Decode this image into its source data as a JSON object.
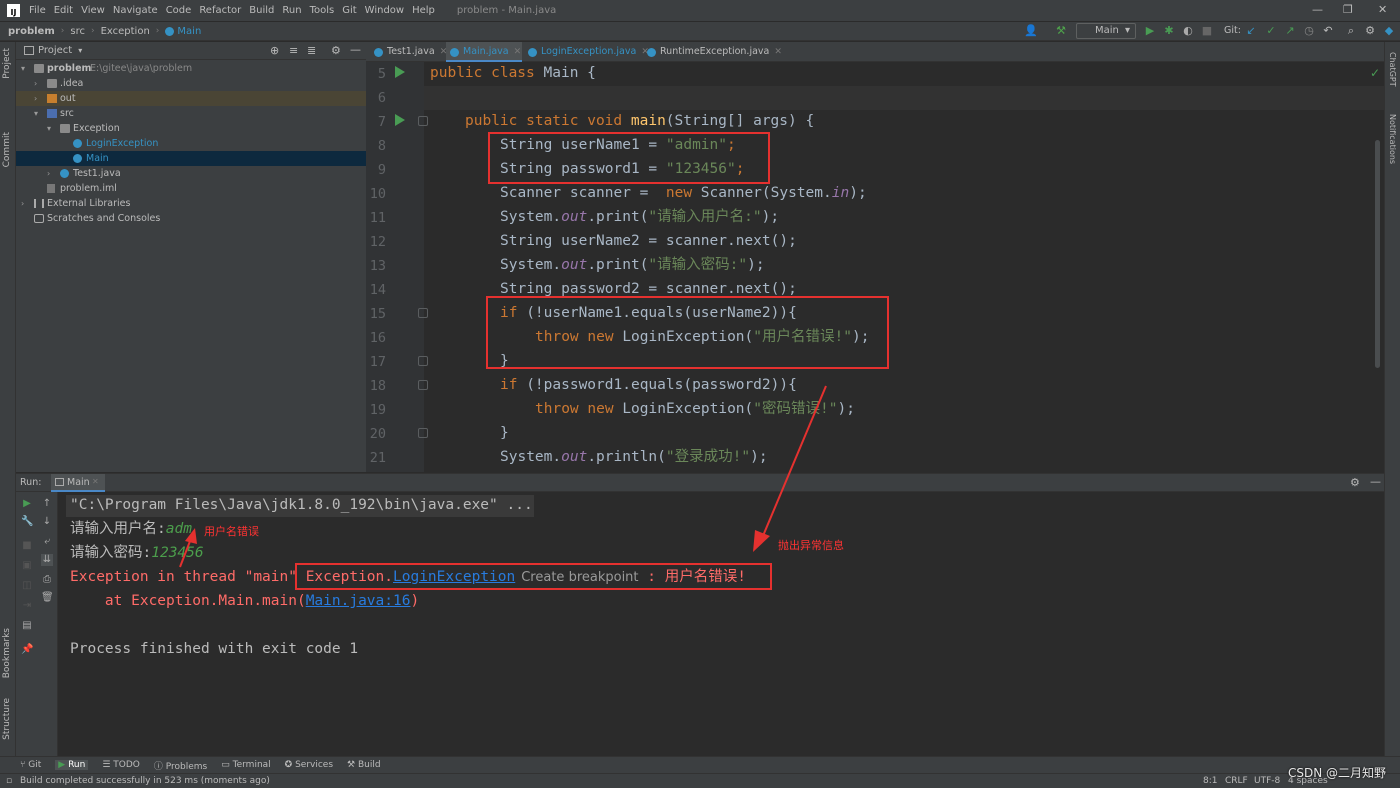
{
  "menubar": {
    "items": [
      "File",
      "Edit",
      "View",
      "Navigate",
      "Code",
      "Refactor",
      "Build",
      "Run",
      "Tools",
      "Git",
      "Window",
      "Help"
    ],
    "window_title": "problem - Main.java",
    "controls": [
      "—",
      "❐",
      "✕"
    ]
  },
  "navbar": {
    "breadcrumbs": [
      "problem",
      "src",
      "Exception",
      "Main"
    ],
    "run_config": "Main",
    "git_label": "Git:"
  },
  "left_strip": {
    "tabs": [
      "Project",
      "Commit",
      "Bookmarks",
      "Structure"
    ]
  },
  "right_strip": {
    "tabs": [
      "ChatGPT",
      "Notifications"
    ]
  },
  "project": {
    "header": "Project",
    "tree": [
      {
        "label": "problem",
        "path": "E:\\gitee\\java\\problem"
      },
      {
        "label": ".idea"
      },
      {
        "label": "out"
      },
      {
        "label": "src"
      },
      {
        "label": "Exception"
      },
      {
        "label": "LoginException"
      },
      {
        "label": "Main"
      },
      {
        "label": "Test1.java"
      },
      {
        "label": "problem.iml"
      },
      {
        "label": "External Libraries"
      },
      {
        "label": "Scratches and Consoles"
      }
    ]
  },
  "editor": {
    "tabs": [
      "Test1.java",
      "Main.java",
      "LoginException.java",
      "RuntimeException.java"
    ],
    "line_numbers": [
      "5",
      "6",
      "7",
      "8",
      "9",
      "10",
      "11",
      "12",
      "13",
      "14",
      "15",
      "16",
      "17",
      "18",
      "19",
      "20",
      "21"
    ],
    "code": {
      "l5a": "public class ",
      "l5b": "Main {",
      "l7a": "public static void ",
      "l7b": "main",
      "l7c": "(String[] args) {",
      "l8a": "String userName1 = ",
      "l8b": "\"admin\"",
      "l8c": ";",
      "l9a": "String password1 = ",
      "l9b": "\"123456\"",
      "l9c": ";",
      "l10a": "Scanner scanner =  ",
      "l10b": "new ",
      "l10c": "Scanner(System.",
      "l10d": "in",
      "l10e": ");",
      "l11a": "System.",
      "l11b": "out",
      "l11c": ".print(",
      "l11d": "\"请输入用户名:\"",
      "l11e": ");",
      "l12": "String userName2 = scanner.next();",
      "l13a": "System.",
      "l13b": "out",
      "l13c": ".print(",
      "l13d": "\"请输入密码:\"",
      "l13e": ");",
      "l14": "String password2 = scanner.next();",
      "l15a": "if ",
      "l15b": "(!userName1.equals(userName2)){",
      "l16a": "throw new ",
      "l16b": "LoginException(",
      "l16c": "\"用户名错误!\"",
      "l16d": ");",
      "l17": "}",
      "l18a": "if ",
      "l18b": "(!password1.equals(password2)){",
      "l19a": "throw new ",
      "l19b": "LoginException(",
      "l19c": "\"密码错误!\"",
      "l19d": ");",
      "l20": "}",
      "l21a": "System.",
      "l21b": "out",
      "l21c": ".println(",
      "l21d": "\"登录成功!\"",
      "l21e": ");"
    }
  },
  "run": {
    "label": "Run:",
    "tab": "Main",
    "console": {
      "cmd": "\"C:\\Program Files\\Java\\jdk1.8.0_192\\bin\\java.exe\" ...",
      "prompt_user": "请输入用户名:",
      "input_user": "adm",
      "prompt_pwd": "请输入密码:",
      "input_pwd": "123456",
      "err_prefix": "Exception in thread \"main\" ",
      "err_pkg": "Exception.",
      "err_class": "LoginException",
      "err_hint": "Create breakpoint",
      "err_msg": " : 用户名错误!",
      "trace_prefix": "    at Exception.Main.main(",
      "trace_link": "Main.java:16",
      "trace_suffix": ")",
      "finished": "Process finished with exit code 1"
    }
  },
  "annotations": {
    "username_error": "用户名错误",
    "exception_info": "抛出异常信息",
    "color": "#e5312f"
  },
  "bottom_tabs": [
    "Git",
    "Run",
    "TODO",
    "Problems",
    "Terminal",
    "Services",
    "Build"
  ],
  "status": {
    "message": "Build completed successfully in 523 ms (moments ago)",
    "position": "8:1",
    "line_sep": "CRLF",
    "encoding": "UTF-8",
    "indent": "4 spaces",
    "watermark": "CSDN @二月知野"
  }
}
